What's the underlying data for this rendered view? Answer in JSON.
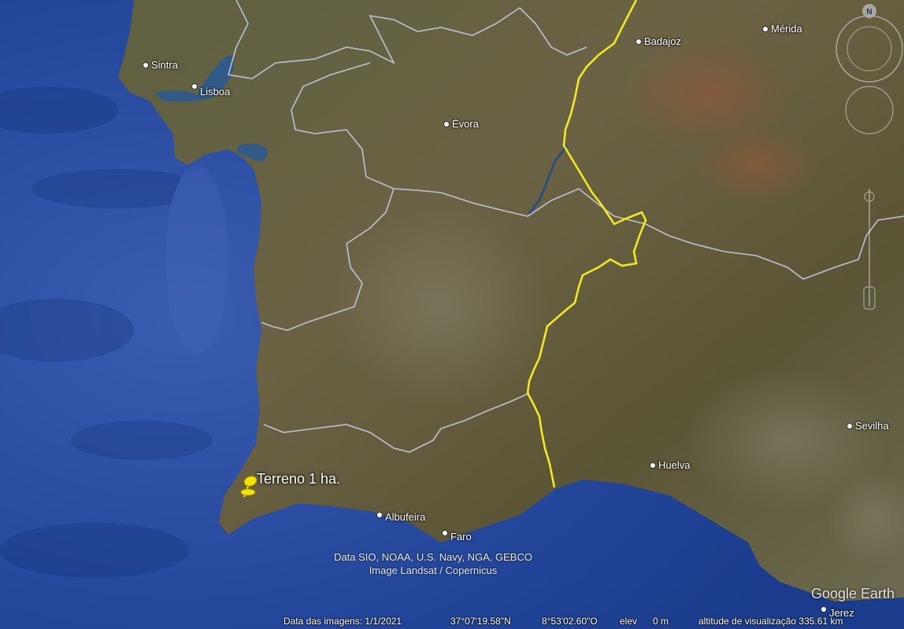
{
  "cities": [
    {
      "id": "sintra",
      "label": "Sintra"
    },
    {
      "id": "lisboa",
      "label": "Lisboa"
    },
    {
      "id": "evora",
      "label": "Évora"
    },
    {
      "id": "badajoz",
      "label": "Badajoz"
    },
    {
      "id": "merida",
      "label": "Mérida"
    },
    {
      "id": "huelva",
      "label": "Huelva"
    },
    {
      "id": "sevilha",
      "label": "Sevilha"
    },
    {
      "id": "albufeira",
      "label": "Albufeira"
    },
    {
      "id": "faro",
      "label": "Faro"
    },
    {
      "id": "jerez",
      "label": "Jerez"
    }
  ],
  "placemark": {
    "label": "Terreno 1 ha.",
    "color": "#f2e600"
  },
  "attribution": {
    "line1": "Data SIO, NOAA, U.S. Navy, NGA, GEBCO",
    "line2": "Image Landsat / Copernicus"
  },
  "status_bar": {
    "imagery_date": "Data das imagens: 1/1/2021",
    "latitude": "37°07'19.58\"N",
    "longitude": "8°53'02.60\"O",
    "elevation": "elev      0 m",
    "eye_altitude": "altitude de visualização 335.61 km"
  },
  "logo": "Google Earth",
  "compass_label": "N",
  "colors": {
    "border_national": "#f0ea1c",
    "border_regional": "#c8cde0",
    "ocean": "#22449a",
    "land": "#5b5a38"
  }
}
